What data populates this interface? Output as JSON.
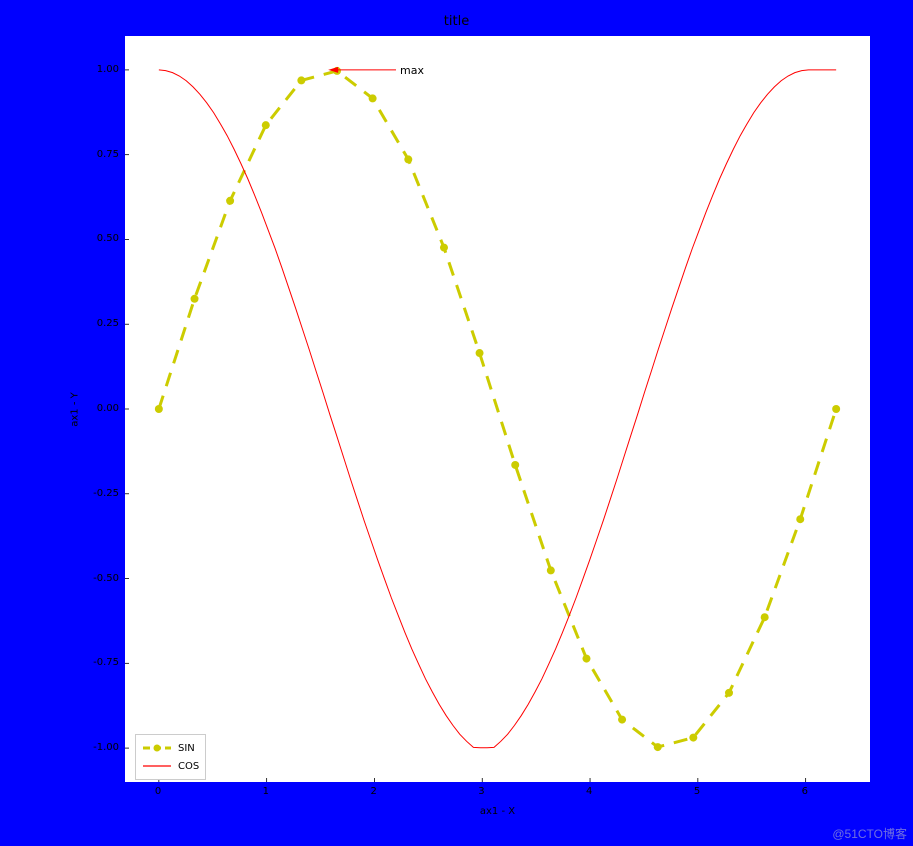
{
  "chart_data": {
    "type": "line",
    "title": "title",
    "xlabel": "ax1 - X",
    "ylabel": "ax1 - Y",
    "xlim": [
      -0.314,
      6.597
    ],
    "ylim": [
      -1.1,
      1.1
    ],
    "xticks": [
      0,
      1,
      2,
      3,
      4,
      5,
      6
    ],
    "yticks": [
      -1.0,
      -0.75,
      -0.5,
      -0.25,
      0.0,
      0.25,
      0.5,
      0.75,
      1.0
    ],
    "series": [
      {
        "name": "SIN",
        "color": "#cccc00",
        "linestyle": "dashed",
        "linewidth": 3,
        "marker": "o",
        "x": [
          0.0,
          0.331,
          0.661,
          0.992,
          1.322,
          1.653,
          1.983,
          2.314,
          2.645,
          2.975,
          3.306,
          3.636,
          3.967,
          4.297,
          4.628,
          4.958,
          5.289,
          5.62,
          5.95,
          6.283
        ],
        "y": [
          0.0,
          0.325,
          0.614,
          0.837,
          0.969,
          0.997,
          0.916,
          0.736,
          0.476,
          0.165,
          -0.165,
          -0.476,
          -0.736,
          -0.916,
          -0.997,
          -0.969,
          -0.837,
          -0.614,
          -0.325,
          0.0
        ]
      },
      {
        "name": "COS",
        "color": "#ff0000",
        "linestyle": "solid",
        "linewidth": 1,
        "marker": "none",
        "x": [
          0.0,
          0.063,
          0.127,
          0.19,
          0.254,
          0.317,
          0.381,
          0.444,
          0.508,
          0.571,
          0.634,
          0.698,
          0.761,
          0.825,
          0.888,
          0.952,
          1.015,
          1.079,
          1.142,
          1.205,
          1.269,
          1.332,
          1.396,
          1.459,
          1.523,
          1.586,
          1.65,
          1.713,
          1.776,
          1.84,
          1.903,
          1.967,
          2.03,
          2.094,
          2.157,
          2.221,
          2.284,
          2.347,
          2.411,
          2.474,
          2.538,
          2.601,
          2.665,
          2.728,
          2.791,
          2.855,
          2.918,
          2.982,
          3.045,
          3.109,
          3.172,
          3.236,
          3.299,
          3.362,
          3.426,
          3.489,
          3.553,
          3.616,
          3.68,
          3.743,
          3.807,
          3.87,
          3.933,
          3.997,
          4.06,
          4.124,
          4.187,
          4.251,
          4.314,
          4.377,
          4.441,
          4.504,
          4.568,
          4.631,
          4.695,
          4.758,
          4.822,
          4.885,
          4.948,
          5.012,
          5.075,
          5.139,
          5.202,
          5.266,
          5.329,
          5.393,
          5.456,
          5.519,
          5.583,
          5.646,
          5.71,
          5.773,
          5.837,
          5.9,
          5.964,
          6.027,
          6.09,
          6.154,
          6.217,
          6.283
        ],
        "y": [
          1.0,
          0.998,
          0.992,
          0.982,
          0.968,
          0.95,
          0.928,
          0.903,
          0.874,
          0.841,
          0.806,
          0.766,
          0.724,
          0.679,
          0.631,
          0.58,
          0.527,
          0.473,
          0.416,
          0.357,
          0.297,
          0.236,
          0.174,
          0.111,
          0.048,
          -0.016,
          -0.079,
          -0.142,
          -0.205,
          -0.267,
          -0.328,
          -0.387,
          -0.445,
          -0.502,
          -0.557,
          -0.609,
          -0.66,
          -0.708,
          -0.753,
          -0.796,
          -0.835,
          -0.871,
          -0.904,
          -0.933,
          -0.959,
          -0.98,
          -0.998,
          -0.999,
          -0.999,
          -0.998,
          -0.98,
          -0.959,
          -0.933,
          -0.904,
          -0.871,
          -0.835,
          -0.796,
          -0.753,
          -0.708,
          -0.66,
          -0.609,
          -0.557,
          -0.502,
          -0.445,
          -0.387,
          -0.328,
          -0.267,
          -0.205,
          -0.142,
          -0.079,
          -0.016,
          0.048,
          0.111,
          0.174,
          0.236,
          0.297,
          0.357,
          0.416,
          0.473,
          0.527,
          0.58,
          0.631,
          0.679,
          0.724,
          0.766,
          0.806,
          0.841,
          0.874,
          0.903,
          0.928,
          0.95,
          0.968,
          0.982,
          0.992,
          0.998,
          1.0,
          1.0,
          1.0,
          1.0,
          1.0
        ]
      }
    ],
    "annotation": {
      "text": "max",
      "xy": [
        1.571,
        1.0
      ],
      "xytext": [
        2.2,
        1.0
      ],
      "arrow_color": "#ff0000"
    },
    "legend_position": "lower-left"
  },
  "watermark": "@51CTO博客"
}
